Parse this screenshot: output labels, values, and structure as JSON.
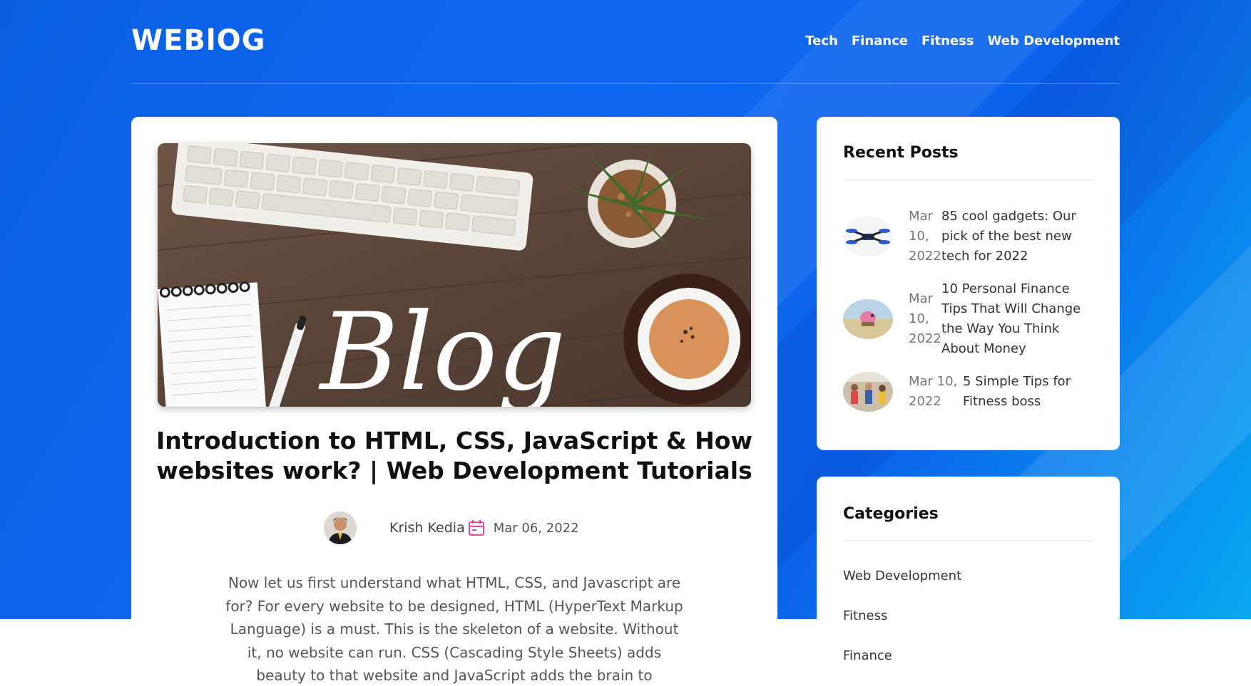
{
  "header": {
    "logo": "WEBlOG",
    "nav": [
      "Tech",
      "Finance",
      "Fitness",
      "Web Development"
    ]
  },
  "post": {
    "image_text": "Blog",
    "title": "Introduction to HTML, CSS, JavaScript & How websites work? | Web Development Tutorials",
    "author": "Krish Kedia",
    "date": "Mar 06, 2022",
    "excerpt": "Now let us first understand what HTML, CSS, and Javascript are for? For every website to be designed, HTML (HyperText Markup Language) is a must. This is the skeleton of a website. Without it, no website can run. CSS (Cascading Style Sheets) adds beauty to that website and JavaScript adds the brain to"
  },
  "recent_posts": {
    "title": "Recent Posts",
    "items": [
      {
        "date": "Mar 10, 2022",
        "title": "85 cool gadgets: Our pick of the best new tech for 2022",
        "thumb": "drone"
      },
      {
        "date": "Mar 10, 2022",
        "title": "10 Personal Finance Tips That Will Change the Way You Think About Money",
        "thumb": "piggy-bank"
      },
      {
        "date": "Mar 10, 2022",
        "title": "5 Simple Tips for Fitness boss",
        "thumb": "gym"
      }
    ]
  },
  "categories": {
    "title": "Categories",
    "items": [
      "Web Development",
      "Fitness",
      "Finance"
    ]
  },
  "colors": {
    "brand_blue": "#0a5fe0",
    "calendar_icon": "#e84a9a"
  }
}
